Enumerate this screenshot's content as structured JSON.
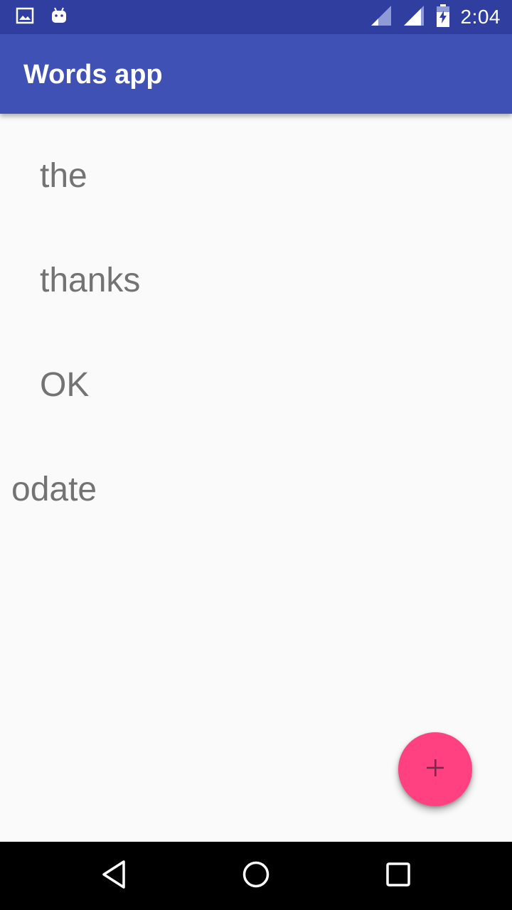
{
  "status_bar": {
    "time": "2:04",
    "icons": [
      "image-icon",
      "android-icon",
      "signal-icon",
      "signal-full-icon",
      "battery-charging-icon"
    ]
  },
  "app_bar": {
    "title": "Words app"
  },
  "words": [
    {
      "text": "the"
    },
    {
      "text": "thanks"
    },
    {
      "text": "OK"
    },
    {
      "text": "odate"
    }
  ],
  "fab": {
    "icon": "add-icon"
  },
  "nav_bar": {
    "icons": [
      "back-icon",
      "home-icon",
      "recents-icon"
    ]
  },
  "colors": {
    "status_bar": "#303f9f",
    "app_bar": "#3f51b5",
    "accent": "#ff4081",
    "word_text": "#737373",
    "background": "#fafafa"
  }
}
